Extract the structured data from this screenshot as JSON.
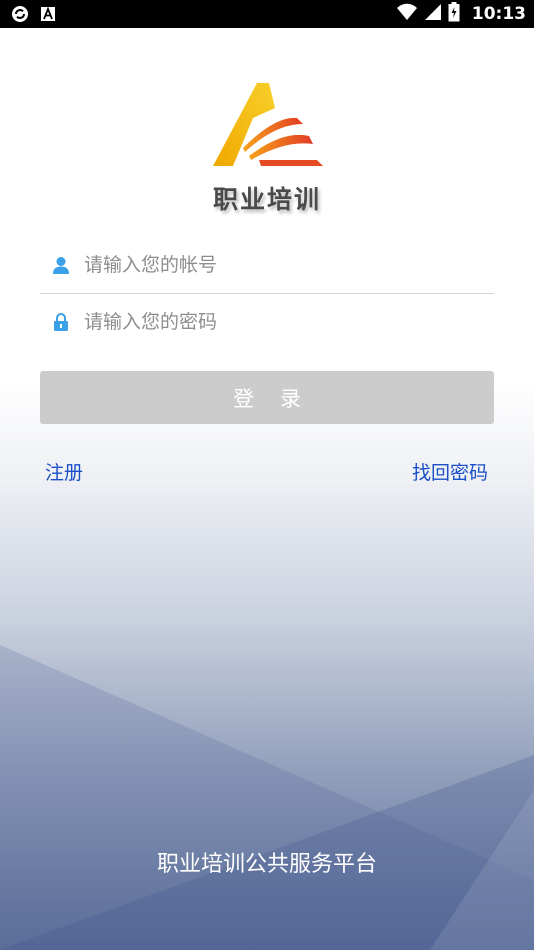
{
  "status_bar": {
    "time": "10:13",
    "icons": [
      "sync-icon",
      "notification-a-icon",
      "wifi-icon",
      "signal-icon",
      "battery-icon"
    ]
  },
  "app": {
    "brand": "职业培训",
    "footer": "职业培训公共服务平台"
  },
  "form": {
    "username_placeholder": "请输入您的帐号",
    "password_placeholder": "请输入您的密码",
    "login_label": "登录",
    "register_label": "注册",
    "forgot_label": "找回密码"
  },
  "colors": {
    "link": "#1a4fc7",
    "icon": "#3aa0e8",
    "button_disabled": "#cccccc",
    "logo_yellow": "#f5b400",
    "logo_red": "#e8412a"
  }
}
